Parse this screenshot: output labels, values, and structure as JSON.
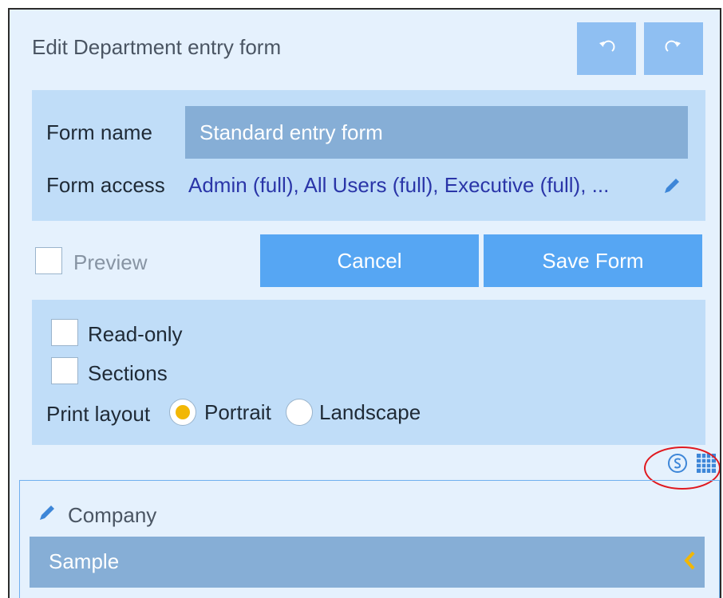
{
  "header": {
    "title": "Edit Department entry form",
    "undo_icon": "undo-icon",
    "redo_icon": "redo-icon"
  },
  "form": {
    "name_label": "Form name",
    "name_value": "Standard entry form",
    "access_label": "Form access",
    "access_value": "Admin (full), All Users (full), Executive (full), ...",
    "access_edit_icon": "pencil-icon"
  },
  "actions": {
    "preview_label": "Preview",
    "preview_checked": false,
    "cancel_label": "Cancel",
    "save_label": "Save Form"
  },
  "options": {
    "readonly_label": "Read-only",
    "readonly_checked": false,
    "sections_label": "Sections",
    "sections_checked": false,
    "print_layout_label": "Print layout",
    "portrait_label": "Portrait",
    "landscape_label": "Landscape",
    "print_layout_selected": "Portrait"
  },
  "toolbar": {
    "icons": [
      "s-circle-icon",
      "grid-table-icon"
    ]
  },
  "section": {
    "title": "Company",
    "edit_icon": "pencil-icon",
    "row_label": "Sample",
    "row_icon": "chevron-left-icon"
  },
  "colors": {
    "background": "#e5f1fd",
    "panel": "#c0ddf8",
    "button": "#56a6f3",
    "button_light": "#8fbff2",
    "input_fill": "#86aed6",
    "link": "#2a35a8",
    "radio_selected": "#f2b705",
    "highlight": "#e0191f"
  }
}
